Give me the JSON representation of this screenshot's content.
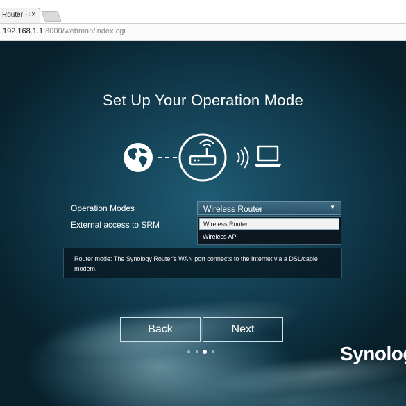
{
  "browser": {
    "tab_title": "Router - Synology",
    "tab_close": "×",
    "url_host": "192.168.1.1",
    "url_path": ":8000/webman/index.cgi"
  },
  "wizard": {
    "title": "Set Up Your Operation Mode",
    "operation_modes_label": "Operation Modes",
    "external_access_label": "External access to SRM",
    "selected_mode": "Wireless Router",
    "dropdown_arrow": "▼",
    "options": [
      "Wireless Router",
      "Wireless AP"
    ],
    "description": "Router mode: The Synology Router's WAN port connects to the Internet via a DSL/cable modem.",
    "back_label": "Back",
    "next_label": "Next",
    "page_indicator": {
      "total": 4,
      "current": 3
    },
    "brand": "Synology"
  },
  "icons": [
    "globe-icon",
    "router-icon",
    "wifi-waves-icon",
    "laptop-icon"
  ],
  "colors": {
    "background": "#10384a",
    "text": "#ffffff",
    "selected_option": "#f2f2f2"
  }
}
